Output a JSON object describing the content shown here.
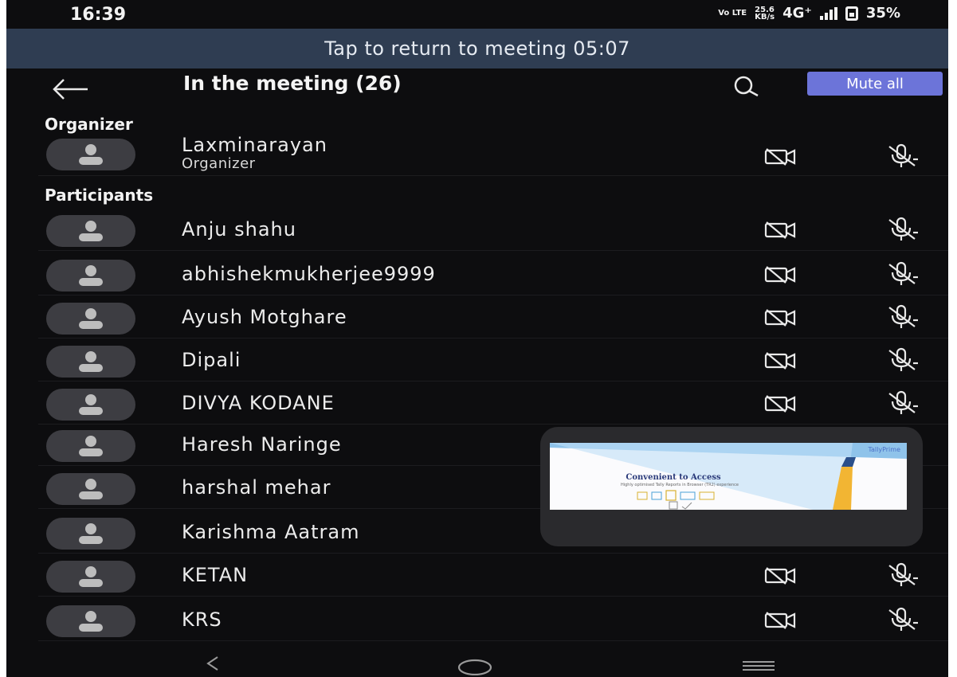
{
  "status_bar": {
    "time": "16:39",
    "volte": "Vo LTE",
    "speed": "25.6",
    "speed_unit": "KB/s",
    "network": "4G⁺",
    "battery": "35%"
  },
  "banner": {
    "text": "Tap to return to meeting",
    "timer": "05:07"
  },
  "header": {
    "title": "In the meeting (26)",
    "mute_all_label": "Mute all"
  },
  "organizer_section": {
    "heading": "Organizer",
    "name": "Laxminarayan",
    "role": "Organizer"
  },
  "participants_section": {
    "heading": "Participants",
    "items": [
      {
        "name": "Anju shahu"
      },
      {
        "name": "abhishekmukherjee9999"
      },
      {
        "name": "Ayush Motghare"
      },
      {
        "name": "Dipali"
      },
      {
        "name": "DIVYA KODANE"
      },
      {
        "name": "Haresh Naringe"
      },
      {
        "name": "harshal mehar"
      },
      {
        "name": "Karishma Aatram"
      },
      {
        "name": "KETAN"
      },
      {
        "name": "KRS"
      }
    ]
  },
  "pip": {
    "brand": "TallyPrime",
    "title": "Convenient to Access",
    "subtitle": "Highly optimised Tally Reports in Browser (TR2) experience"
  },
  "icons": {
    "camera": "camera-off-icon",
    "mic": "mic-off-icon"
  },
  "colors": {
    "background": "#0d0d0f",
    "banner": "#2f3d52",
    "accent": "#6c74d9"
  }
}
